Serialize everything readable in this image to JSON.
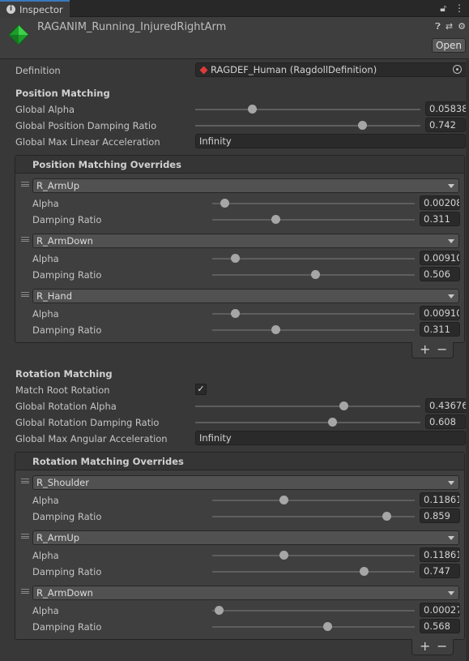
{
  "tab": {
    "title": "Inspector",
    "icon": "info-icon"
  },
  "header": {
    "asset_name": "RAGANIM_Running_InjuredRightArm",
    "open_label": "Open",
    "icons": [
      "help-icon",
      "settings-sliders-icon",
      "gear-icon"
    ]
  },
  "definition": {
    "label": "Definition",
    "value": "RAGDEF_Human (RagdollDefinition)"
  },
  "position": {
    "heading": "Position Matching",
    "global_alpha": {
      "label": "Global Alpha",
      "value": "0.05838",
      "fraction": 0.25
    },
    "global_damping": {
      "label": "Global Position Damping Ratio",
      "value": "0.742",
      "fraction": 0.742
    },
    "max_accel": {
      "label": "Global Max Linear Acceleration",
      "value": "Infinity"
    },
    "overrides": {
      "heading": "Position Matching Overrides",
      "items": [
        {
          "bone": "R_ArmUp",
          "alpha_label": "Alpha",
          "alpha": "0.00208",
          "alpha_f": 0.06,
          "damp_label": "Damping Ratio",
          "damp": "0.311",
          "damp_f": 0.311
        },
        {
          "bone": "R_ArmDown",
          "alpha_label": "Alpha",
          "alpha": "0.00910",
          "alpha_f": 0.11,
          "damp_label": "Damping Ratio",
          "damp": "0.506",
          "damp_f": 0.506
        },
        {
          "bone": "R_Hand",
          "alpha_label": "Alpha",
          "alpha": "0.00910",
          "alpha_f": 0.11,
          "damp_label": "Damping Ratio",
          "damp": "0.311",
          "damp_f": 0.311
        }
      ]
    }
  },
  "rotation": {
    "heading": "Rotation Matching",
    "match_root": {
      "label": "Match Root Rotation",
      "checked": true
    },
    "global_alpha": {
      "label": "Global Rotation Alpha",
      "value": "0.43676",
      "fraction": 0.66
    },
    "global_damping": {
      "label": "Global Rotation Damping Ratio",
      "value": "0.608",
      "fraction": 0.608
    },
    "max_accel": {
      "label": "Global Max Angular Acceleration",
      "value": "Infinity"
    },
    "overrides": {
      "heading": "Rotation Matching Overrides",
      "items": [
        {
          "bone": "R_Shoulder",
          "alpha_label": "Alpha",
          "alpha": "0.11861",
          "alpha_f": 0.35,
          "damp_label": "Damping Ratio",
          "damp": "0.859",
          "damp_f": 0.859
        },
        {
          "bone": "R_ArmUp",
          "alpha_label": "Alpha",
          "alpha": "0.11861",
          "alpha_f": 0.35,
          "damp_label": "Damping Ratio",
          "damp": "0.747",
          "damp_f": 0.747
        },
        {
          "bone": "R_ArmDown",
          "alpha_label": "Alpha",
          "alpha": "0.00027",
          "alpha_f": 0.03,
          "damp_label": "Damping Ratio",
          "damp": "0.568",
          "damp_f": 0.568
        }
      ]
    }
  },
  "list_footer": {
    "add": "+",
    "remove": "−"
  }
}
